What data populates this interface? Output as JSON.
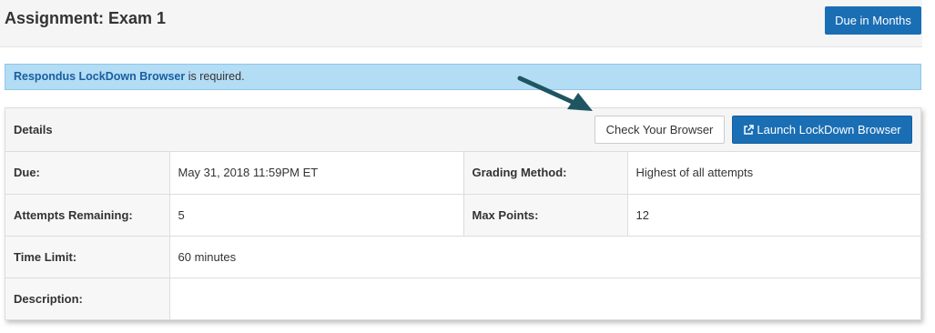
{
  "header": {
    "title": "Assignment: Exam 1",
    "due_button": "Due in Months"
  },
  "alert": {
    "link_text": "Respondus LockDown Browser",
    "message": " is required."
  },
  "details": {
    "title": "Details",
    "check_button": "Check Your Browser",
    "launch_button": "Launch LockDown Browser",
    "launch_icon": "external-link-icon",
    "rows": [
      {
        "label1": "Due:",
        "value1": "May 31, 2018 11:59PM ET",
        "label2": "Grading Method:",
        "value2": "Highest of all attempts"
      },
      {
        "label1": "Attempts Remaining:",
        "value1": "5",
        "label2": "Max Points:",
        "value2": "12"
      },
      {
        "label1": "Time Limit:",
        "value1": "60 minutes"
      },
      {
        "label1": "Description:",
        "value1": ""
      }
    ]
  },
  "colors": {
    "primary": "#1a6eb4",
    "alert_bg": "#b3dcf5",
    "annotation_arrow": "#1f5560"
  }
}
